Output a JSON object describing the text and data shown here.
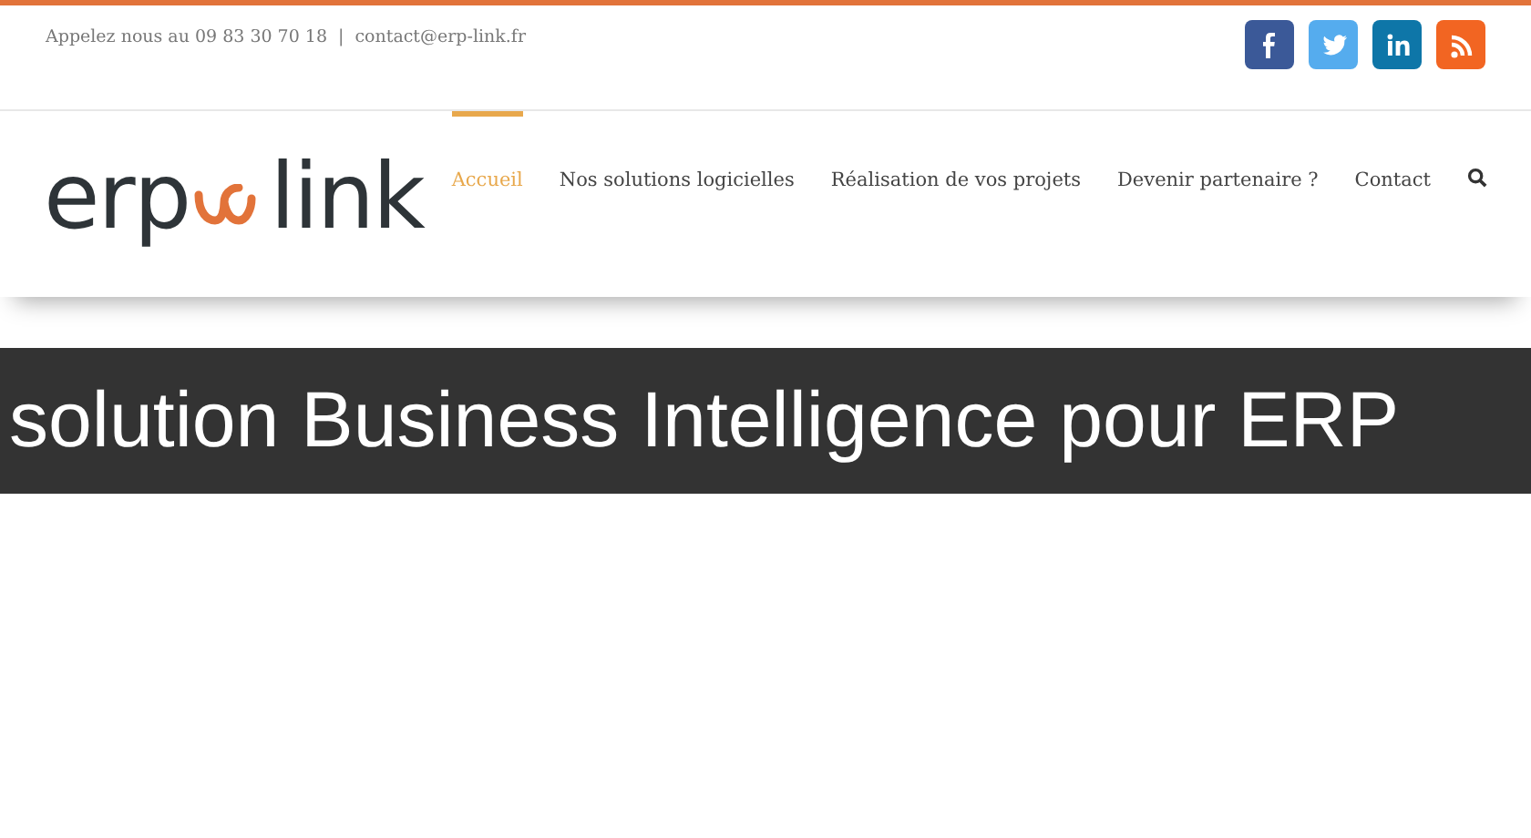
{
  "topbar": {
    "phone": "Appelez nous au 09 83 30 70 18",
    "separator": "|",
    "email": "contact@erp-link.fr",
    "social": [
      {
        "kind": "facebook",
        "color": "#3b5998"
      },
      {
        "kind": "twitter",
        "color": "#55acee"
      },
      {
        "kind": "linkedin",
        "color": "#0e76a8"
      },
      {
        "kind": "rss",
        "color": "#f26522"
      }
    ]
  },
  "logo": {
    "left": "erp",
    "right": "link"
  },
  "nav": [
    {
      "label": "Accueil",
      "selected": true
    },
    {
      "label": "Nos solutions logicielles",
      "selected": false
    },
    {
      "label": "Réalisation de vos projets",
      "selected": false
    },
    {
      "label": "Devenir partenaire ?",
      "selected": false
    },
    {
      "label": "Contact",
      "selected": false
    }
  ],
  "banner": {
    "title": "solution Business Intelligence pour ERP"
  }
}
